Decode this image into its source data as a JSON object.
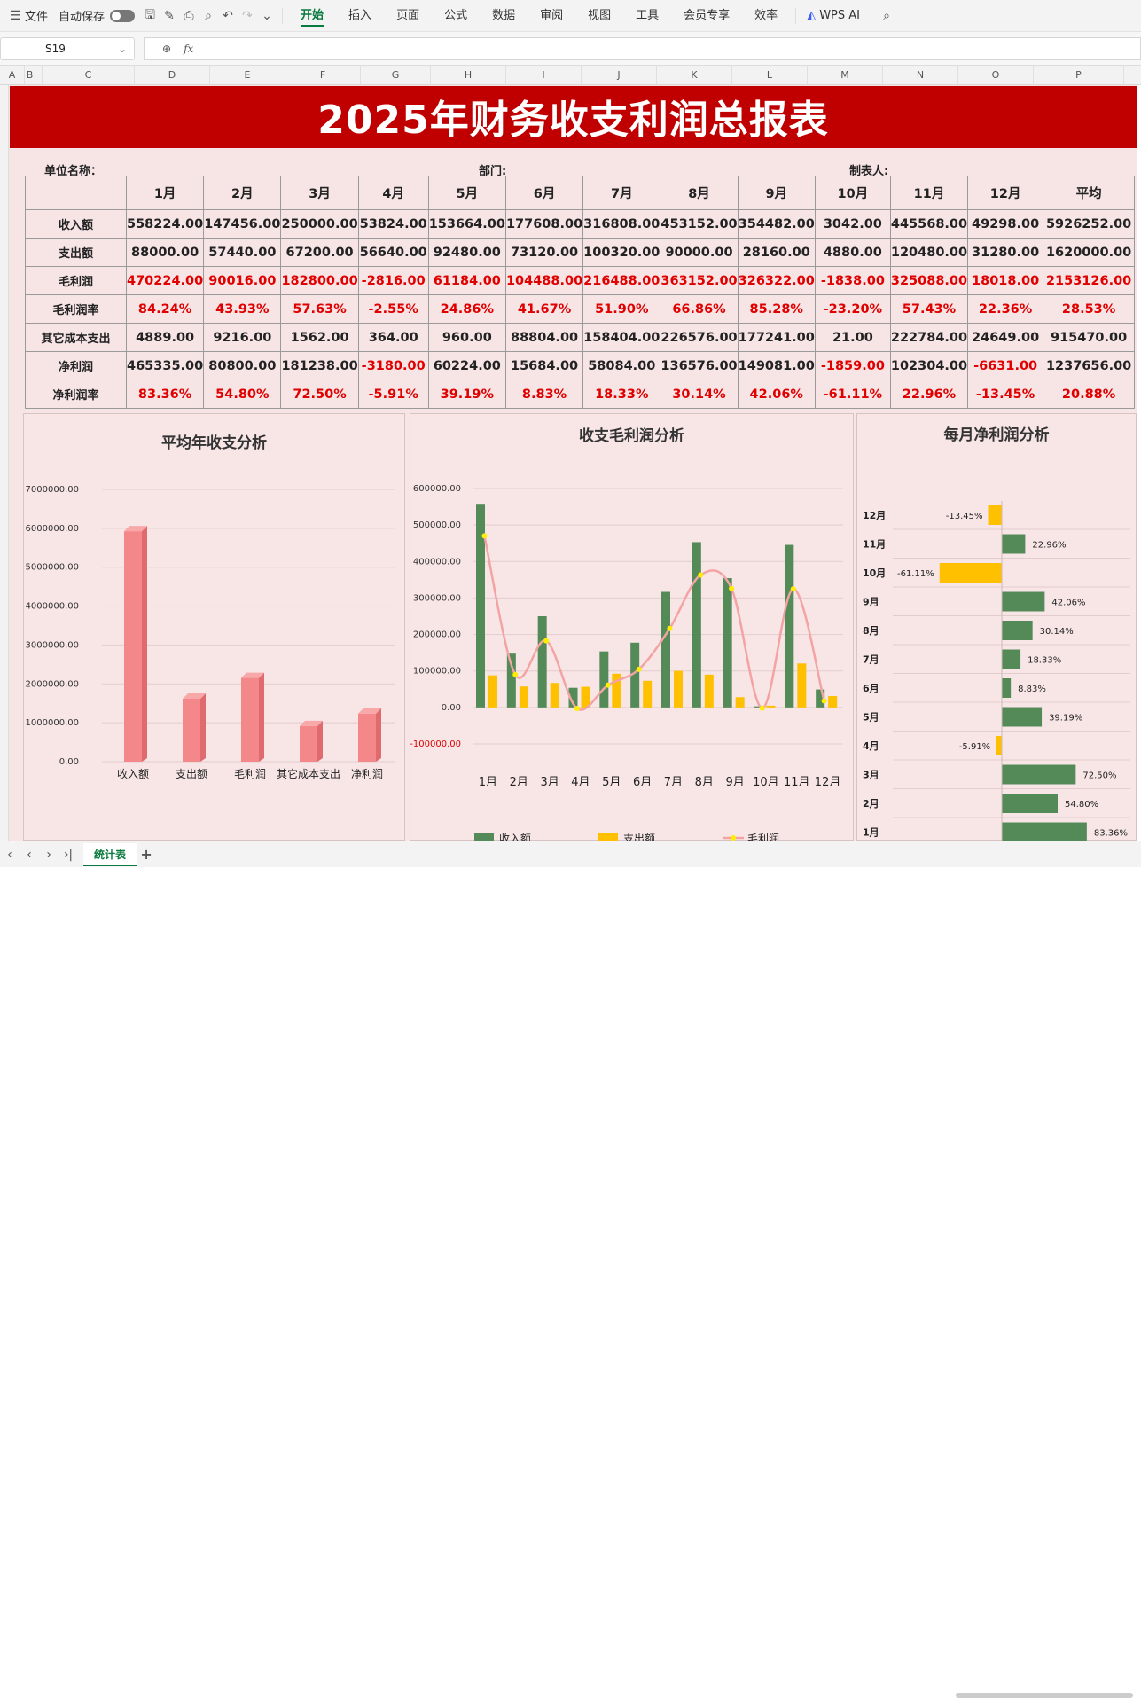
{
  "toolbar": {
    "file": "文件",
    "autosave": "自动保存",
    "tabs": [
      "开始",
      "插入",
      "页面",
      "公式",
      "数据",
      "审阅",
      "视图",
      "工具",
      "会员专享",
      "效率"
    ],
    "wps_ai": "WPS AI"
  },
  "formula_bar": {
    "cell_ref": "S19",
    "fx": "fx"
  },
  "columns": [
    "A",
    "B",
    "C",
    "D",
    "E",
    "F",
    "G",
    "H",
    "I",
    "J",
    "K",
    "L",
    "M",
    "N",
    "O",
    "P"
  ],
  "report": {
    "title": "2025年财务收支利润总报表",
    "unit_label": "单位名称：",
    "dept_label": "部门:",
    "maker_label": "制表人:",
    "months": [
      "1月",
      "2月",
      "3月",
      "4月",
      "5月",
      "6月",
      "7月",
      "8月",
      "9月",
      "10月",
      "11月",
      "12月"
    ],
    "avg_label": "平均",
    "rows": [
      {
        "label": "收入额",
        "values": [
          "558224.00",
          "147456.00",
          "250000.00",
          "53824.00",
          "153664.00",
          "177608.00",
          "316808.00",
          "453152.00",
          "354482.00",
          "3042.00",
          "445568.00",
          "49298.00"
        ],
        "avg": "5926252.00",
        "style": "black"
      },
      {
        "label": "支出额",
        "values": [
          "88000.00",
          "57440.00",
          "67200.00",
          "56640.00",
          "92480.00",
          "73120.00",
          "100320.00",
          "90000.00",
          "28160.00",
          "4880.00",
          "120480.00",
          "31280.00"
        ],
        "avg": "1620000.00",
        "style": "black"
      },
      {
        "label": "毛利润",
        "values": [
          "470224.00",
          "90016.00",
          "182800.00",
          "-2816.00",
          "61184.00",
          "104488.00",
          "216488.00",
          "363152.00",
          "326322.00",
          "-1838.00",
          "325088.00",
          "18018.00"
        ],
        "avg": "2153126.00",
        "style": "red"
      },
      {
        "label": "毛利润率",
        "values": [
          "84.24%",
          "43.93%",
          "57.63%",
          "-2.55%",
          "24.86%",
          "41.67%",
          "51.90%",
          "66.86%",
          "85.28%",
          "-23.20%",
          "57.43%",
          "22.36%"
        ],
        "avg": "28.53%",
        "style": "red"
      },
      {
        "label": "其它成本支出",
        "values": [
          "4889.00",
          "9216.00",
          "1562.00",
          "364.00",
          "960.00",
          "88804.00",
          "158404.00",
          "226576.00",
          "177241.00",
          "21.00",
          "222784.00",
          "24649.00"
        ],
        "avg": "915470.00",
        "style": "black"
      },
      {
        "label": "净利润",
        "values": [
          "465335.00",
          "80800.00",
          "181238.00",
          "-3180.00",
          "60224.00",
          "15684.00",
          "58084.00",
          "136576.00",
          "149081.00",
          "-1859.00",
          "102304.00",
          "-6631.00"
        ],
        "avg": "1237656.00",
        "style": "mixed"
      },
      {
        "label": "净利润率",
        "values": [
          "83.36%",
          "54.80%",
          "72.50%",
          "-5.91%",
          "39.19%",
          "8.83%",
          "18.33%",
          "30.14%",
          "42.06%",
          "-61.11%",
          "22.96%",
          "-13.45%"
        ],
        "avg": "20.88%",
        "style": "red"
      }
    ]
  },
  "chart_data": [
    {
      "type": "bar",
      "title": "平均年收支分析",
      "categories": [
        "收入额",
        "支出额",
        "毛利润",
        "其它成本支出",
        "净利润"
      ],
      "values": [
        5926252,
        1620000,
        2153126,
        915470,
        1237656
      ],
      "ylim": [
        0,
        7000000
      ],
      "yticks": [
        "0.00",
        "1000000.00",
        "2000000.00",
        "3000000.00",
        "4000000.00",
        "5000000.00",
        "6000000.00",
        "7000000.00"
      ],
      "color": "#f4878a"
    },
    {
      "type": "bar",
      "title": "收支毛利润分析",
      "categories": [
        "1月",
        "2月",
        "3月",
        "4月",
        "5月",
        "6月",
        "7月",
        "8月",
        "9月",
        "10月",
        "11月",
        "12月"
      ],
      "series": [
        {
          "name": "收入额",
          "type": "bar",
          "color": "#548a58",
          "values": [
            558224,
            147456,
            250000,
            53824,
            153664,
            177608,
            316808,
            453152,
            354482,
            3042,
            445568,
            49298
          ]
        },
        {
          "name": "支出额",
          "type": "bar",
          "color": "#ffc000",
          "values": [
            88000,
            57440,
            67200,
            56640,
            92480,
            73120,
            100320,
            90000,
            28160,
            4880,
            120480,
            31280
          ]
        },
        {
          "name": "毛利润",
          "type": "line",
          "color": "#f4a3a3",
          "values": [
            470224,
            90016,
            182800,
            -2816,
            61184,
            104488,
            216488,
            363152,
            326322,
            -1838,
            325088,
            18018
          ]
        }
      ],
      "ylim": [
        -100000,
        600000
      ],
      "yticks": [
        "-100000.00",
        "0.00",
        "100000.00",
        "200000.00",
        "300000.00",
        "400000.00",
        "500000.00",
        "600000.00"
      ],
      "legend": "bottom"
    },
    {
      "type": "bar",
      "orientation": "horizontal",
      "title": "每月净利润分析",
      "categories": [
        "12月",
        "11月",
        "10月",
        "9月",
        "8月",
        "7月",
        "6月",
        "5月",
        "4月",
        "3月",
        "2月",
        "1月"
      ],
      "values": [
        -13.45,
        22.96,
        -61.11,
        42.06,
        30.14,
        18.33,
        8.83,
        39.19,
        -5.91,
        72.5,
        54.8,
        83.36
      ],
      "labels": [
        "-13.45%",
        "22.96%",
        "-61.11%",
        "42.06%",
        "30.14%",
        "18.33%",
        "8.83%",
        "39.19%",
        "-5.91%",
        "72.50%",
        "54.80%",
        "83.36%"
      ],
      "positive_color": "#548a58",
      "negative_color": "#ffc000"
    }
  ],
  "sheet_tab": "统计表"
}
